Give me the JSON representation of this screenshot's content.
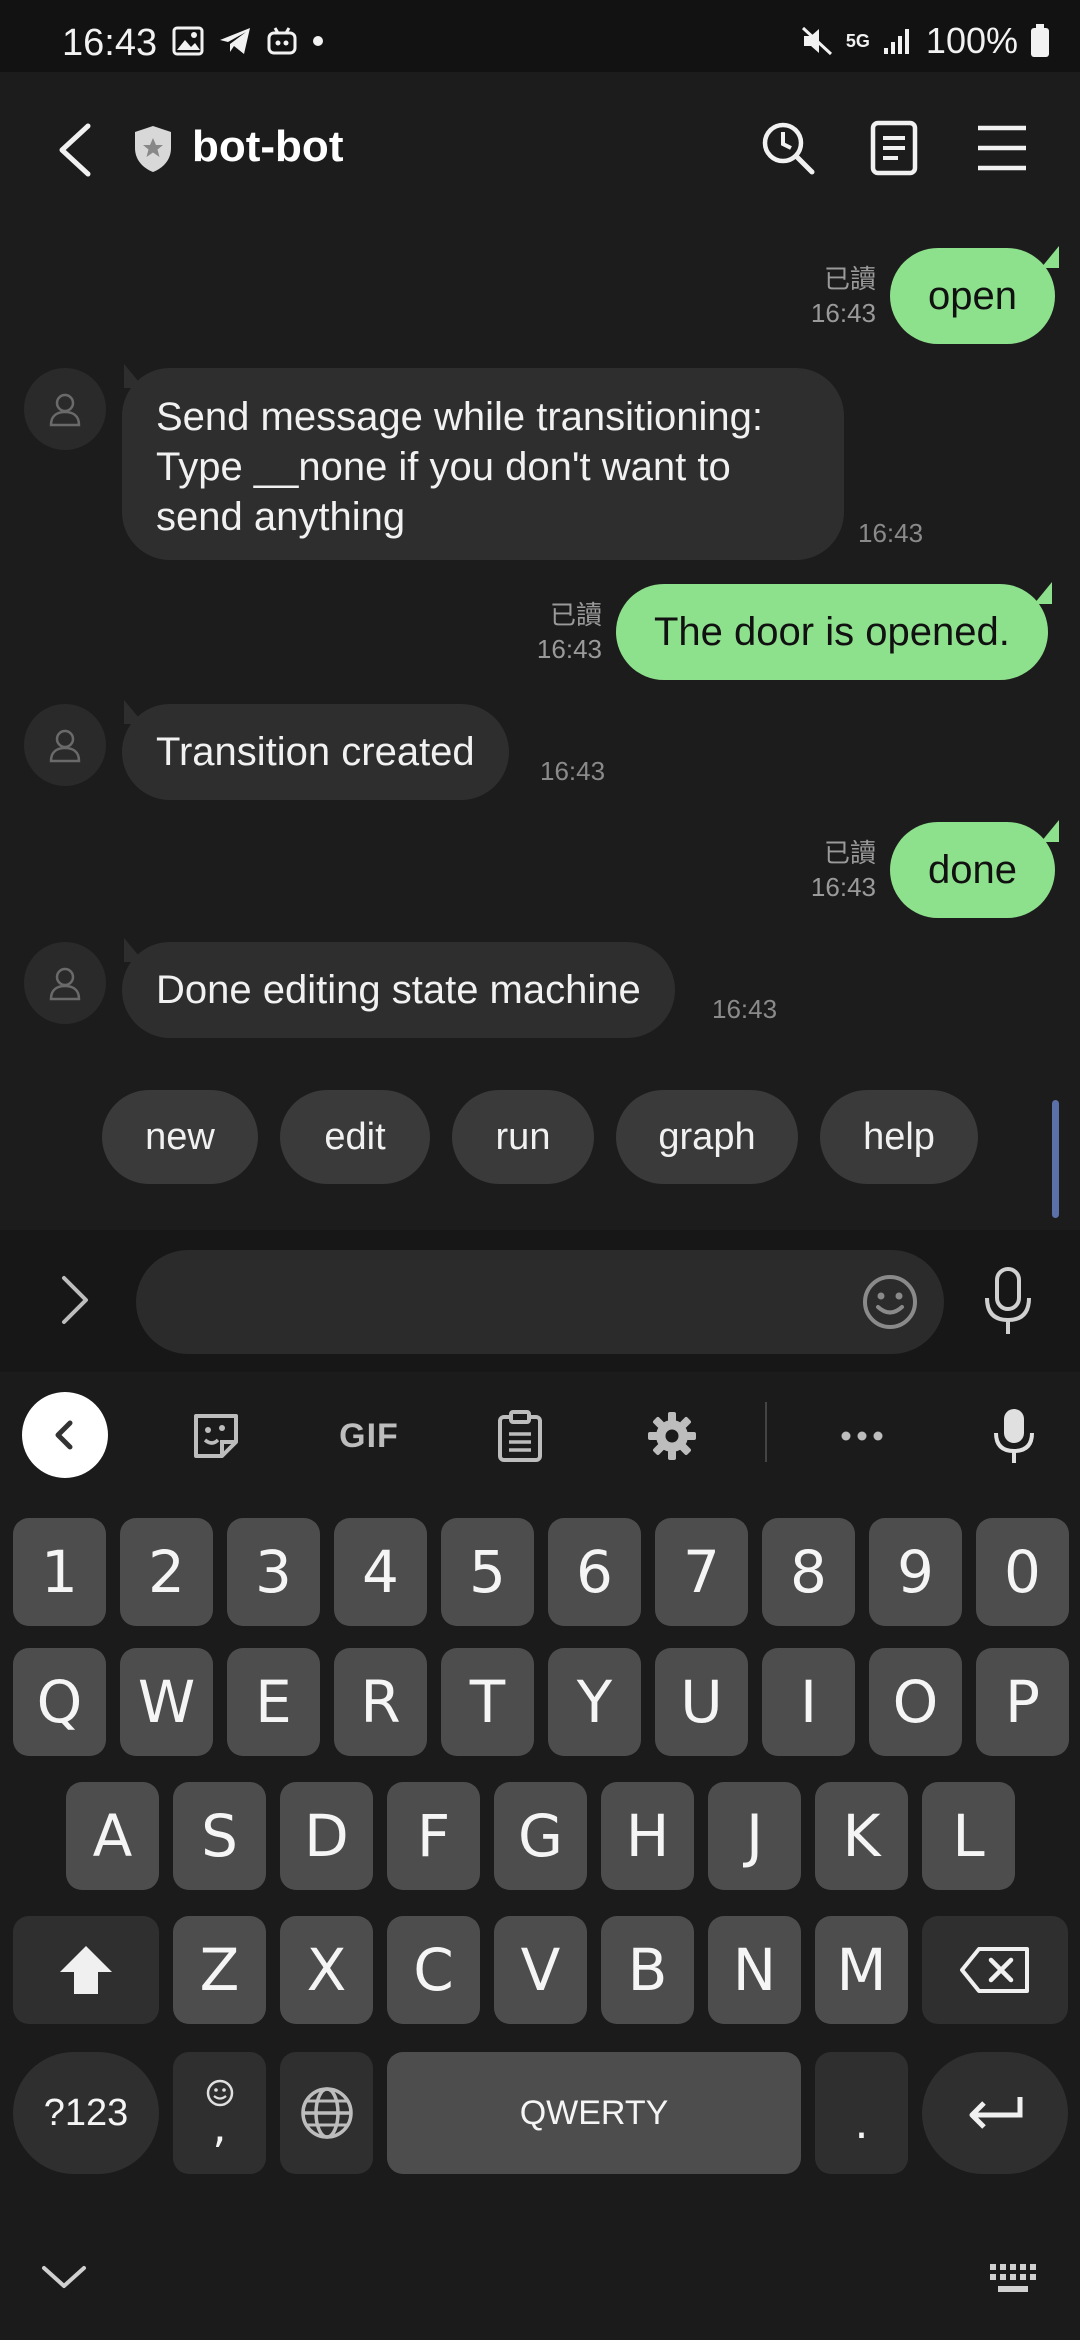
{
  "status": {
    "time": "16:43",
    "network": "5G",
    "battery": "100%"
  },
  "header": {
    "title": "bot-bot"
  },
  "messages": {
    "m1": {
      "text": "open",
      "read": "已讀",
      "time": "16:43"
    },
    "m2": {
      "line1": "Send message while transitioning:",
      "line2": "Type __none if you don't want to",
      "line3": "send anything",
      "time": "16:43"
    },
    "m3": {
      "text": "The door is opened.",
      "read": "已讀",
      "time": "16:43"
    },
    "m4": {
      "text": "Transition created",
      "time": "16:43"
    },
    "m5": {
      "text": "done",
      "read": "已讀",
      "time": "16:43"
    },
    "m6": {
      "text": "Done editing state machine",
      "time": "16:43"
    }
  },
  "quick_replies": [
    "new",
    "edit",
    "run",
    "graph",
    "help"
  ],
  "input": {
    "placeholder": ""
  },
  "keyboard": {
    "gif_label": "GIF",
    "row_numbers": [
      "1",
      "2",
      "3",
      "4",
      "5",
      "6",
      "7",
      "8",
      "9",
      "0"
    ],
    "row_q": [
      "Q",
      "W",
      "E",
      "R",
      "T",
      "Y",
      "U",
      "I",
      "O",
      "P"
    ],
    "row_a": [
      "A",
      "S",
      "D",
      "F",
      "G",
      "H",
      "J",
      "K",
      "L"
    ],
    "row_z": [
      "Z",
      "X",
      "C",
      "V",
      "B",
      "N",
      "M"
    ],
    "symbols_label": "?123",
    "comma": ",",
    "space_label": "QWERTY",
    "period": "."
  }
}
